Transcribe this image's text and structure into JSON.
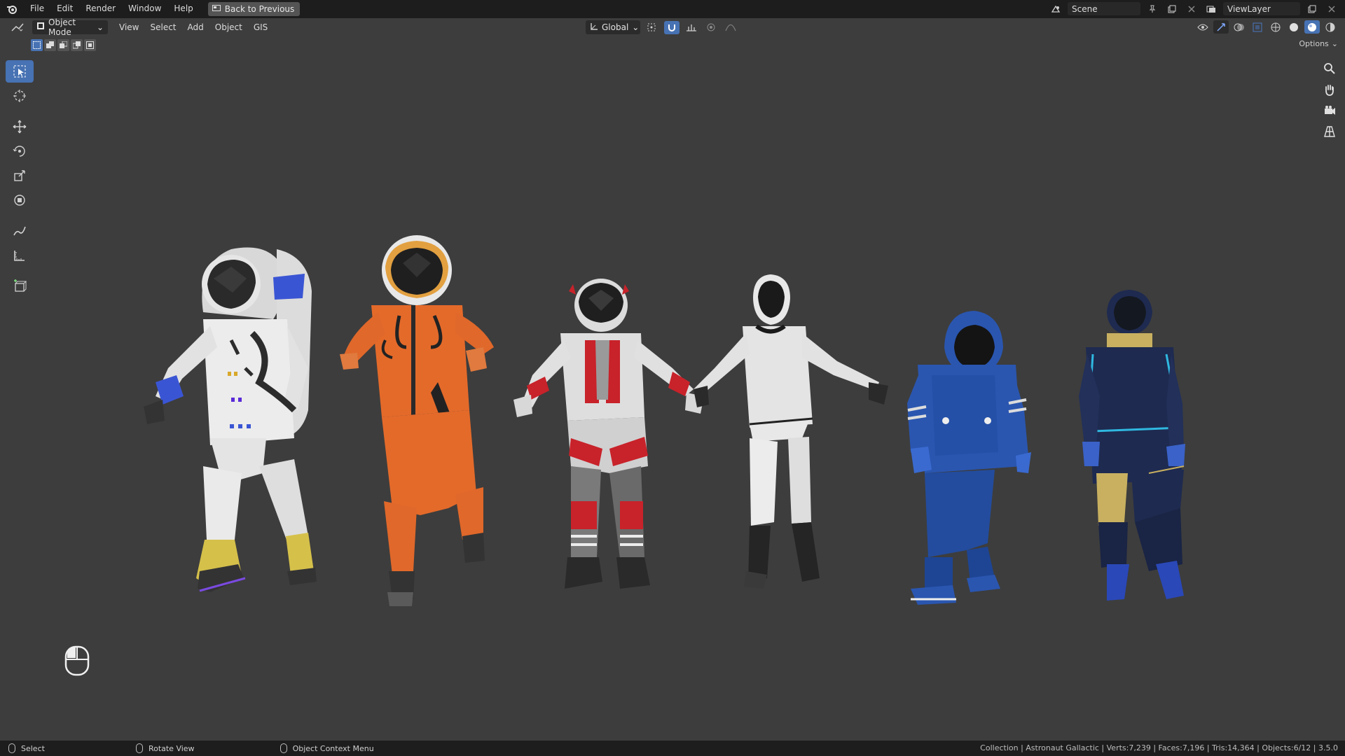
{
  "app": {
    "menu": [
      "File",
      "Edit",
      "Render",
      "Window",
      "Help"
    ],
    "back_button": "Back to Previous",
    "scene_name": "Scene",
    "view_layer": "ViewLayer"
  },
  "viewport_header": {
    "mode": "Object Mode",
    "menus": [
      "View",
      "Select",
      "Add",
      "Object",
      "GIS"
    ],
    "orientation": "Global",
    "options": "Options"
  },
  "toolbar": {
    "tools": [
      "select-box",
      "cursor",
      "move",
      "rotate",
      "scale",
      "transform",
      "annotate",
      "measure",
      "add-cube"
    ],
    "active": "select-box"
  },
  "navigation": [
    "zoom-icon",
    "pan-hand-icon",
    "camera-icon",
    "grid-view-icon"
  ],
  "figures": [
    {
      "name": "astronaut-white-classic",
      "suit": "#e8e8e8",
      "accent": "#3a4fd0"
    },
    {
      "name": "astronaut-orange",
      "suit": "#e06a2c",
      "accent": "#222222"
    },
    {
      "name": "astronaut-red-white",
      "suit": "#dcdcdc",
      "accent": "#c8222a"
    },
    {
      "name": "astronaut-white-slim",
      "suit": "#e4e4e4",
      "accent": "#1c1c1c"
    },
    {
      "name": "astronaut-blue",
      "suit": "#2a56b0",
      "accent": "#dcdcdc"
    },
    {
      "name": "astronaut-navy",
      "suit": "#1e2a50",
      "accent": "#2fb8e0"
    }
  ],
  "statusbar": {
    "select": "Select",
    "rotate": "Rotate View",
    "context": "Object Context Menu",
    "info": "Collection | Astronaut Gallactic | Verts:7,239 | Faces:7,196 | Tris:14,364 | Objects:6/12 | 3.5.0"
  }
}
